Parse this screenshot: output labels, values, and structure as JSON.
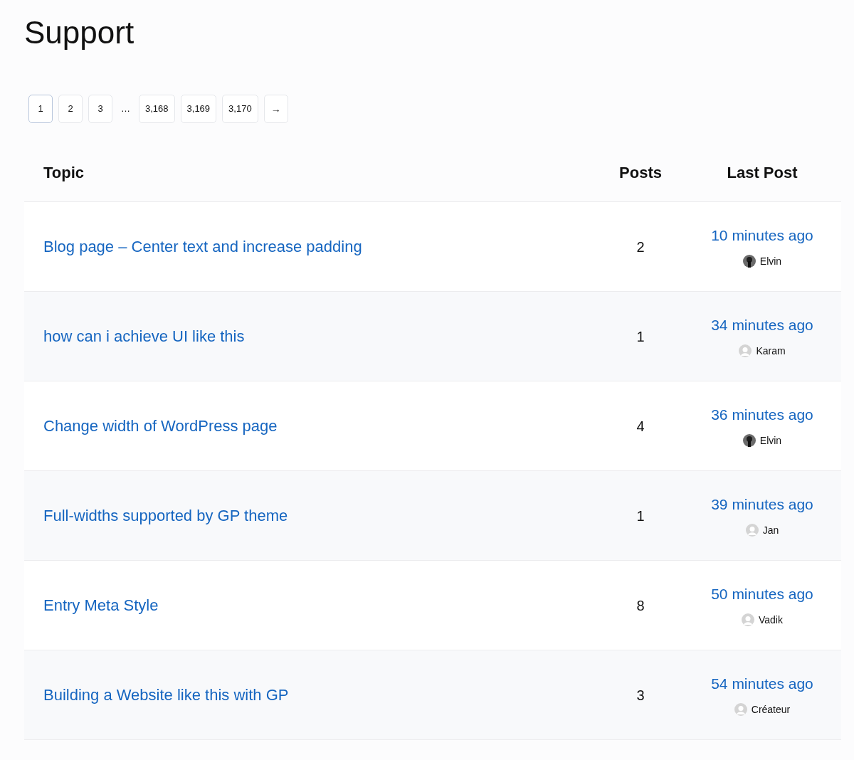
{
  "title": "Support",
  "pagination": [
    {
      "kind": "page",
      "label": "1",
      "selected": true
    },
    {
      "kind": "page",
      "label": "2",
      "selected": false
    },
    {
      "kind": "page",
      "label": "3",
      "selected": false
    },
    {
      "kind": "ellipsis",
      "label": "…"
    },
    {
      "kind": "page",
      "label": "3,168",
      "selected": false
    },
    {
      "kind": "page",
      "label": "3,169",
      "selected": false
    },
    {
      "kind": "page",
      "label": "3,170",
      "selected": false
    },
    {
      "kind": "next",
      "label": "→"
    }
  ],
  "table": {
    "columns": [
      "Topic",
      "Posts",
      "Last Post"
    ],
    "rows": [
      {
        "topic": "Blog page – Center text and increase padding",
        "posts": "2",
        "last_post": "10 minutes ago",
        "author": "Elvin",
        "avatar": {
          "kind": "photo"
        }
      },
      {
        "topic": "how can i achieve UI like this",
        "posts": "1",
        "last_post": "34 minutes ago",
        "author": "Karam",
        "avatar": {
          "kind": "default"
        }
      },
      {
        "topic": "Change width of WordPress page",
        "posts": "4",
        "last_post": "36 minutes ago",
        "author": "Elvin",
        "avatar": {
          "kind": "photo"
        }
      },
      {
        "topic": "Full-widths supported by GP theme",
        "posts": "1",
        "last_post": "39 minutes ago",
        "author": "Jan",
        "avatar": {
          "kind": "default"
        }
      },
      {
        "topic": "Entry Meta Style",
        "posts": "8",
        "last_post": "50 minutes ago",
        "author": "Vadik",
        "avatar": {
          "kind": "default"
        }
      },
      {
        "topic": "Building a Website like this with GP",
        "posts": "3",
        "last_post": "54 minutes ago",
        "author": "Créateur",
        "avatar": {
          "kind": "default"
        }
      }
    ]
  }
}
